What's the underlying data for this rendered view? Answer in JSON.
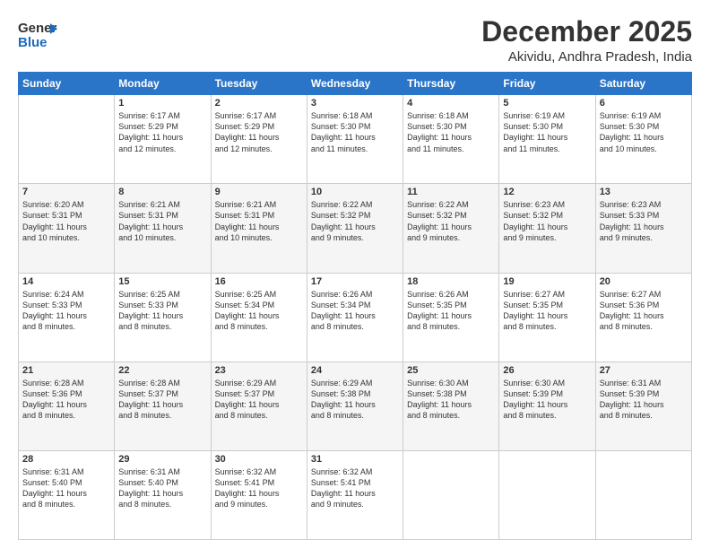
{
  "logo": {
    "line1": "General",
    "line2": "Blue",
    "icon": "▶"
  },
  "header": {
    "month": "December 2025",
    "location": "Akividu, Andhra Pradesh, India"
  },
  "weekdays": [
    "Sunday",
    "Monday",
    "Tuesday",
    "Wednesday",
    "Thursday",
    "Friday",
    "Saturday"
  ],
  "weeks": [
    [
      {
        "day": "",
        "info": ""
      },
      {
        "day": "1",
        "info": "Sunrise: 6:17 AM\nSunset: 5:29 PM\nDaylight: 11 hours\nand 12 minutes."
      },
      {
        "day": "2",
        "info": "Sunrise: 6:17 AM\nSunset: 5:29 PM\nDaylight: 11 hours\nand 12 minutes."
      },
      {
        "day": "3",
        "info": "Sunrise: 6:18 AM\nSunset: 5:30 PM\nDaylight: 11 hours\nand 11 minutes."
      },
      {
        "day": "4",
        "info": "Sunrise: 6:18 AM\nSunset: 5:30 PM\nDaylight: 11 hours\nand 11 minutes."
      },
      {
        "day": "5",
        "info": "Sunrise: 6:19 AM\nSunset: 5:30 PM\nDaylight: 11 hours\nand 11 minutes."
      },
      {
        "day": "6",
        "info": "Sunrise: 6:19 AM\nSunset: 5:30 PM\nDaylight: 11 hours\nand 10 minutes."
      }
    ],
    [
      {
        "day": "7",
        "info": "Sunrise: 6:20 AM\nSunset: 5:31 PM\nDaylight: 11 hours\nand 10 minutes."
      },
      {
        "day": "8",
        "info": "Sunrise: 6:21 AM\nSunset: 5:31 PM\nDaylight: 11 hours\nand 10 minutes."
      },
      {
        "day": "9",
        "info": "Sunrise: 6:21 AM\nSunset: 5:31 PM\nDaylight: 11 hours\nand 10 minutes."
      },
      {
        "day": "10",
        "info": "Sunrise: 6:22 AM\nSunset: 5:32 PM\nDaylight: 11 hours\nand 9 minutes."
      },
      {
        "day": "11",
        "info": "Sunrise: 6:22 AM\nSunset: 5:32 PM\nDaylight: 11 hours\nand 9 minutes."
      },
      {
        "day": "12",
        "info": "Sunrise: 6:23 AM\nSunset: 5:32 PM\nDaylight: 11 hours\nand 9 minutes."
      },
      {
        "day": "13",
        "info": "Sunrise: 6:23 AM\nSunset: 5:33 PM\nDaylight: 11 hours\nand 9 minutes."
      }
    ],
    [
      {
        "day": "14",
        "info": "Sunrise: 6:24 AM\nSunset: 5:33 PM\nDaylight: 11 hours\nand 8 minutes."
      },
      {
        "day": "15",
        "info": "Sunrise: 6:25 AM\nSunset: 5:33 PM\nDaylight: 11 hours\nand 8 minutes."
      },
      {
        "day": "16",
        "info": "Sunrise: 6:25 AM\nSunset: 5:34 PM\nDaylight: 11 hours\nand 8 minutes."
      },
      {
        "day": "17",
        "info": "Sunrise: 6:26 AM\nSunset: 5:34 PM\nDaylight: 11 hours\nand 8 minutes."
      },
      {
        "day": "18",
        "info": "Sunrise: 6:26 AM\nSunset: 5:35 PM\nDaylight: 11 hours\nand 8 minutes."
      },
      {
        "day": "19",
        "info": "Sunrise: 6:27 AM\nSunset: 5:35 PM\nDaylight: 11 hours\nand 8 minutes."
      },
      {
        "day": "20",
        "info": "Sunrise: 6:27 AM\nSunset: 5:36 PM\nDaylight: 11 hours\nand 8 minutes."
      }
    ],
    [
      {
        "day": "21",
        "info": "Sunrise: 6:28 AM\nSunset: 5:36 PM\nDaylight: 11 hours\nand 8 minutes."
      },
      {
        "day": "22",
        "info": "Sunrise: 6:28 AM\nSunset: 5:37 PM\nDaylight: 11 hours\nand 8 minutes."
      },
      {
        "day": "23",
        "info": "Sunrise: 6:29 AM\nSunset: 5:37 PM\nDaylight: 11 hours\nand 8 minutes."
      },
      {
        "day": "24",
        "info": "Sunrise: 6:29 AM\nSunset: 5:38 PM\nDaylight: 11 hours\nand 8 minutes."
      },
      {
        "day": "25",
        "info": "Sunrise: 6:30 AM\nSunset: 5:38 PM\nDaylight: 11 hours\nand 8 minutes."
      },
      {
        "day": "26",
        "info": "Sunrise: 6:30 AM\nSunset: 5:39 PM\nDaylight: 11 hours\nand 8 minutes."
      },
      {
        "day": "27",
        "info": "Sunrise: 6:31 AM\nSunset: 5:39 PM\nDaylight: 11 hours\nand 8 minutes."
      }
    ],
    [
      {
        "day": "28",
        "info": "Sunrise: 6:31 AM\nSunset: 5:40 PM\nDaylight: 11 hours\nand 8 minutes."
      },
      {
        "day": "29",
        "info": "Sunrise: 6:31 AM\nSunset: 5:40 PM\nDaylight: 11 hours\nand 8 minutes."
      },
      {
        "day": "30",
        "info": "Sunrise: 6:32 AM\nSunset: 5:41 PM\nDaylight: 11 hours\nand 9 minutes."
      },
      {
        "day": "31",
        "info": "Sunrise: 6:32 AM\nSunset: 5:41 PM\nDaylight: 11 hours\nand 9 minutes."
      },
      {
        "day": "",
        "info": ""
      },
      {
        "day": "",
        "info": ""
      },
      {
        "day": "",
        "info": ""
      }
    ]
  ]
}
